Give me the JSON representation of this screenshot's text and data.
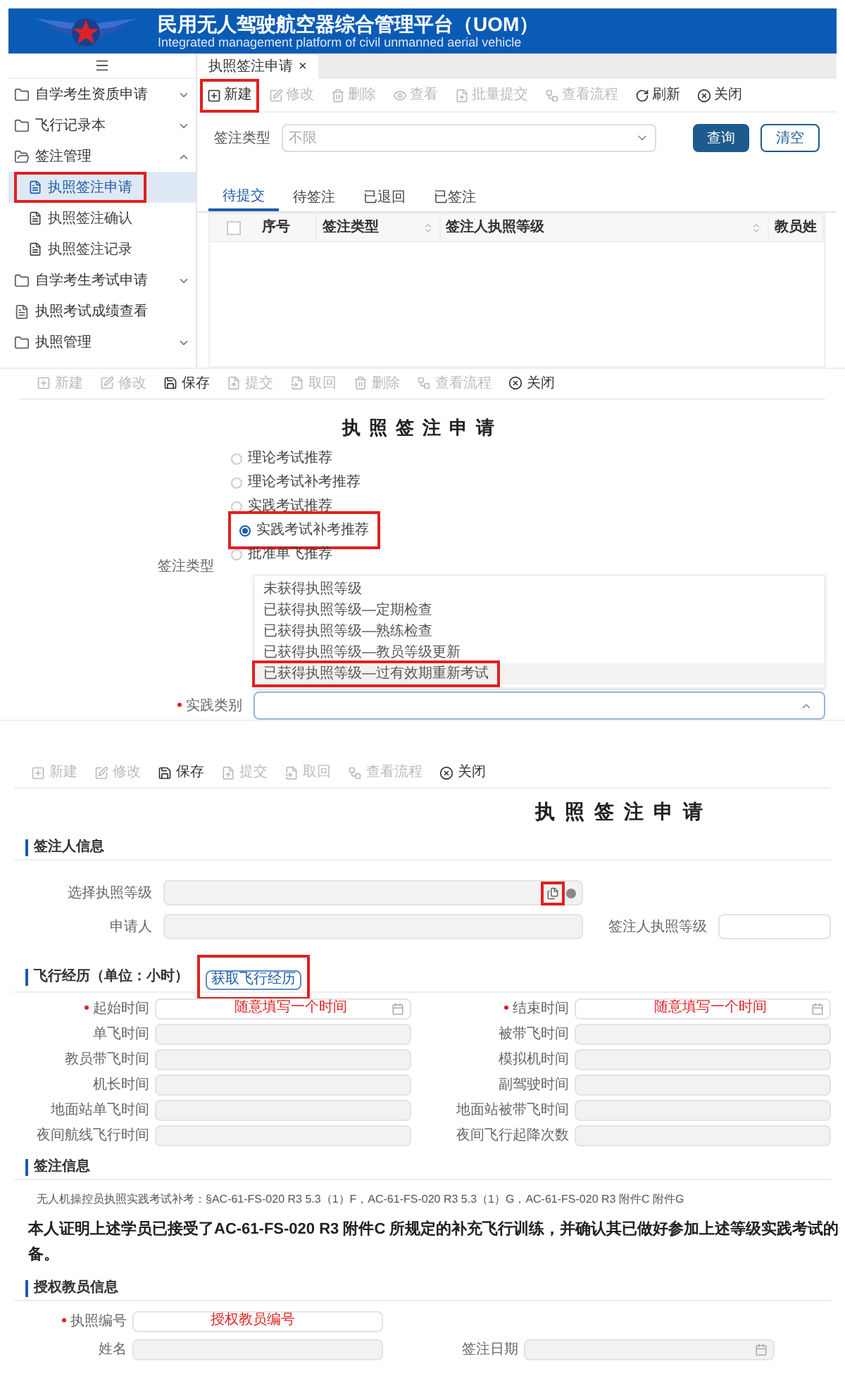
{
  "header": {
    "title": "民用无人驾驶航空器综合管理平台（UOM）",
    "subtitle": "Integrated management platform of civil unmanned aerial vehicle"
  },
  "sidebar": {
    "items": [
      {
        "label": "自学考生资质申请",
        "kind": "folder",
        "expanded": false
      },
      {
        "label": "飞行记录本",
        "kind": "folder",
        "expanded": false
      },
      {
        "label": "签注管理",
        "kind": "folder",
        "expanded": true,
        "children": [
          {
            "label": "执照签注申请",
            "selected": true,
            "highlighted": true
          },
          {
            "label": "执照签注确认",
            "selected": false,
            "highlighted": false
          },
          {
            "label": "执照签注记录",
            "selected": false,
            "highlighted": false
          }
        ]
      },
      {
        "label": "自学考生考试申请",
        "kind": "folder",
        "expanded": false
      },
      {
        "label": "执照考试成绩查看",
        "kind": "page"
      },
      {
        "label": "执照管理",
        "kind": "folder",
        "expanded": false
      }
    ]
  },
  "list_view": {
    "tab": {
      "label": "执照签注申请",
      "close": "×"
    },
    "toolbar": [
      {
        "label": "新建",
        "disabled": false,
        "highlighted": true
      },
      {
        "label": "修改",
        "disabled": true,
        "highlighted": false
      },
      {
        "label": "删除",
        "disabled": true,
        "highlighted": false
      },
      {
        "label": "查看",
        "disabled": true,
        "highlighted": false
      },
      {
        "label": "批量提交",
        "disabled": true,
        "highlighted": false
      },
      {
        "label": "查看流程",
        "disabled": true,
        "highlighted": false
      },
      {
        "label": "刷新",
        "disabled": false,
        "highlighted": false
      },
      {
        "label": "关闭",
        "disabled": false,
        "highlighted": false
      }
    ],
    "filter": {
      "label": "签注类型",
      "placeholder": "不限"
    },
    "buttons": [
      {
        "label": "查询",
        "kind": "primary"
      },
      {
        "label": "清空",
        "kind": "outline"
      }
    ],
    "tabs": [
      {
        "label": "待提交",
        "selected": true
      },
      {
        "label": "待签注",
        "selected": false
      },
      {
        "label": "已退回",
        "selected": false
      },
      {
        "label": "已签注",
        "selected": false
      }
    ],
    "table": {
      "select_all": {
        "checked": false
      },
      "columns": [
        "序号",
        "签注类型",
        "签注人执照等级",
        "教员姓"
      ]
    }
  },
  "type_form": {
    "toolbar": [
      {
        "label": "新建",
        "disabled": true
      },
      {
        "label": "修改",
        "disabled": true
      },
      {
        "label": "保存",
        "disabled": false
      },
      {
        "label": "提交",
        "disabled": true
      },
      {
        "label": "取回",
        "disabled": true
      },
      {
        "label": "删除",
        "disabled": true
      },
      {
        "label": "查看流程",
        "disabled": true
      },
      {
        "label": "关闭",
        "disabled": false
      }
    ],
    "title": "执照签注申请",
    "radio_label": "签注类型",
    "radios": [
      {
        "label": "理论考试推荐",
        "selected": false,
        "highlighted": false
      },
      {
        "label": "理论考试补考推荐",
        "selected": false,
        "highlighted": false
      },
      {
        "label": "实践考试推荐",
        "selected": false,
        "highlighted": false
      },
      {
        "label": "实践考试补考推荐",
        "selected": true,
        "highlighted": true
      },
      {
        "label": "批准单飞推荐",
        "selected": false,
        "highlighted": false
      }
    ],
    "dropdown_options": [
      {
        "label": "未获得执照等级",
        "selected": false
      },
      {
        "label": "已获得执照等级—定期检查",
        "selected": false
      },
      {
        "label": "已获得执照等级—熟练检查",
        "selected": false
      },
      {
        "label": "已获得执照等级—教员等级更新",
        "selected": false
      },
      {
        "label": "已获得执照等级—过有效期重新考试",
        "selected": true
      }
    ],
    "field": {
      "label": "实践类别",
      "required": true,
      "expanded": true
    }
  },
  "detail_form": {
    "toolbar": [
      {
        "label": "新建",
        "disabled": true
      },
      {
        "label": "修改",
        "disabled": true
      },
      {
        "label": "保存",
        "disabled": false
      },
      {
        "label": "提交",
        "disabled": true
      },
      {
        "label": "取回",
        "disabled": true
      },
      {
        "label": "查看流程",
        "disabled": true
      },
      {
        "label": "关闭",
        "disabled": false
      }
    ],
    "title": "执照签注申请",
    "applicant_section": {
      "title": "签注人信息",
      "grade_field": {
        "label": "选择执照等级"
      },
      "applicant_field": {
        "label": "申请人"
      },
      "grade_field_2": {
        "label": "签注人执照等级"
      }
    },
    "flight_section": {
      "title": "飞行经历（单位：小时）",
      "button": "获取飞行经历",
      "fields": [
        {
          "label": "起始时间",
          "required": true,
          "kind": "date",
          "annotation": "随意填写一个时间"
        },
        {
          "label": "结束时间",
          "required": true,
          "kind": "date",
          "annotation": "随意填写一个时间"
        },
        {
          "label": "单飞时间",
          "required": false,
          "kind": "readonly"
        },
        {
          "label": "被带飞时间",
          "required": false,
          "kind": "readonly"
        },
        {
          "label": "教员带飞时间",
          "required": false,
          "kind": "readonly"
        },
        {
          "label": "模拟机时间",
          "required": false,
          "kind": "readonly"
        },
        {
          "label": "机长时间",
          "required": false,
          "kind": "readonly"
        },
        {
          "label": "副驾驶时间",
          "required": false,
          "kind": "readonly"
        },
        {
          "label": "地面站单飞时间",
          "required": false,
          "kind": "readonly"
        },
        {
          "label": "地面站被带飞时间",
          "required": false,
          "kind": "readonly"
        },
        {
          "label": "夜间航线飞行时间",
          "required": false,
          "kind": "readonly"
        },
        {
          "label": "夜间飞行起降次数",
          "required": false,
          "kind": "readonly"
        }
      ]
    },
    "endorsement_section": {
      "title": "签注信息",
      "note": "无人机操控员执照实践考试补考：§AC-61-FS-020 R3 5.3（1）F，AC-61-FS-020 R3 5.3（1）G，AC-61-FS-020 R3 附件C 附件G",
      "statement_lines": [
        "本人证明上述学员已接受了AC-61-FS-020 R3 附件C 所规定的补充飞行训练，并确认其已做好参加上述等级实践考试的",
        "备。"
      ]
    },
    "instructor_section": {
      "title": "授权教员信息",
      "fields": [
        {
          "label": "执照编号",
          "required": true,
          "kind": "input",
          "annotation": "授权教员编号"
        },
        {
          "label": "姓名",
          "required": false,
          "kind": "readonly"
        },
        {
          "label": "签注日期",
          "required": false,
          "kind": "readonly_date"
        }
      ]
    }
  }
}
